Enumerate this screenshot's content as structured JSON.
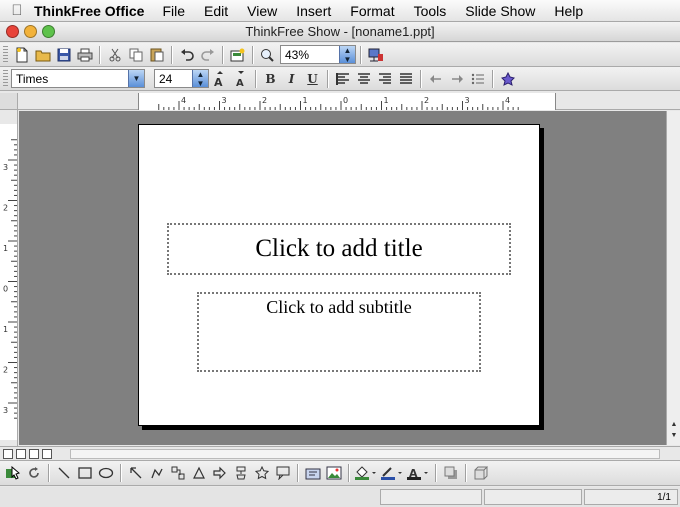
{
  "menubar": {
    "app_name": "ThinkFree Office",
    "items": [
      "File",
      "Edit",
      "View",
      "Insert",
      "Format",
      "Tools",
      "Slide Show",
      "Help"
    ]
  },
  "window": {
    "title": "ThinkFree Show - [noname1.ppt]"
  },
  "toolbar": {
    "zoom": "43%"
  },
  "format_bar": {
    "font_name": "Times",
    "font_size": "24",
    "bold": "B",
    "italic": "I",
    "underline": "U"
  },
  "hruler_labels": [
    "4",
    "3",
    "2",
    "1",
    "0",
    "1",
    "2",
    "3",
    "4"
  ],
  "vruler_labels": [
    "3",
    "2",
    "1",
    "0",
    "1",
    "2",
    "3"
  ],
  "slide": {
    "title_placeholder": "Click to add title",
    "subtitle_placeholder": "Click to add subtitle"
  },
  "status": {
    "page": "1/1"
  },
  "colors": {
    "workspace": "#808080",
    "close": "#e8443a",
    "minimize": "#f2b23a",
    "zoom": "#5ec24b"
  }
}
